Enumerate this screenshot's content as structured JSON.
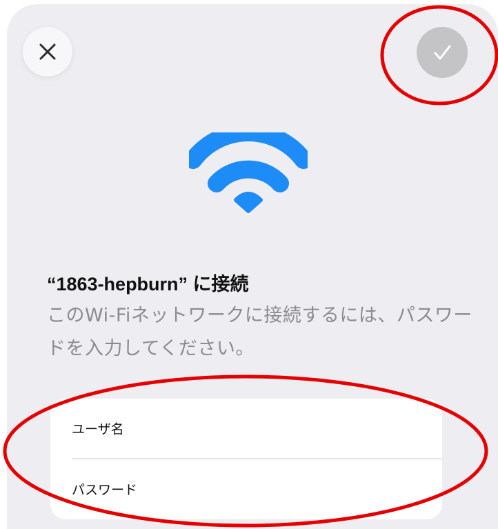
{
  "header": {
    "close_icon": "close-x-icon",
    "confirm_icon": "checkmark-icon",
    "confirm_enabled": false
  },
  "status_icon": "wifi-icon",
  "heading": {
    "title": "“1863-hepburn” に接続",
    "description": "このWi-Fiネットワークに接続するには、パスワードを入力してください。"
  },
  "form": {
    "username": {
      "label": "ユーザ名",
      "value": ""
    },
    "password": {
      "label": "パスワード",
      "value": ""
    }
  },
  "colors": {
    "wifi_blue": "#1e8cf7",
    "confirm_disabled_bg": "#c4c4c6",
    "annotation_red": "#e60000",
    "sheet_bg": "#eeeef2"
  }
}
